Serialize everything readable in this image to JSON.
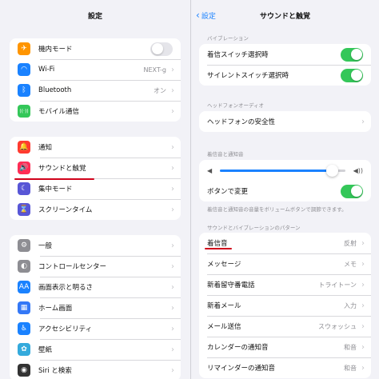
{
  "left": {
    "title": "設定",
    "group1": [
      {
        "label": "機内モード",
        "icon": "airplane-icon",
        "color": "#ff9500",
        "glyph": "✈",
        "control": "toggle-off"
      },
      {
        "label": "Wi-Fi",
        "icon": "wifi-icon",
        "color": "#1a82ff",
        "glyph": "◠",
        "value": "NEXT-g"
      },
      {
        "label": "Bluetooth",
        "icon": "bluetooth-icon",
        "color": "#1a82ff",
        "glyph": "ᛒ",
        "value": "オン"
      },
      {
        "label": "モバイル通信",
        "icon": "cellular-icon",
        "color": "#34c759",
        "glyph": "((·))"
      }
    ],
    "group2": [
      {
        "label": "通知",
        "icon": "bell-icon",
        "color": "#ff3b30",
        "glyph": "🔔"
      },
      {
        "label": "サウンドと触覚",
        "icon": "speaker-icon",
        "color": "#ff2d55",
        "glyph": "🔊"
      },
      {
        "label": "集中モード",
        "icon": "moon-icon",
        "color": "#5856d6",
        "glyph": "☾"
      },
      {
        "label": "スクリーンタイム",
        "icon": "hourglass-icon",
        "color": "#5856d6",
        "glyph": "⌛"
      }
    ],
    "group3": [
      {
        "label": "一般",
        "icon": "gear-icon",
        "color": "#8e8e93",
        "glyph": "⚙"
      },
      {
        "label": "コントロールセンター",
        "icon": "toggles-icon",
        "color": "#8e8e93",
        "glyph": "◐"
      },
      {
        "label": "画面表示と明るさ",
        "icon": "text-size-icon",
        "color": "#1a82ff",
        "glyph": "AA"
      },
      {
        "label": "ホーム画面",
        "icon": "grid-icon",
        "color": "#3478f6",
        "glyph": "▦"
      },
      {
        "label": "アクセシビリティ",
        "icon": "accessibility-icon",
        "color": "#1a82ff",
        "glyph": "♿"
      },
      {
        "label": "壁紙",
        "icon": "wallpaper-icon",
        "color": "#34aadc",
        "glyph": "✿"
      },
      {
        "label": "Siri と検索",
        "icon": "siri-icon",
        "color": "#333333",
        "glyph": "◉"
      }
    ]
  },
  "right": {
    "back_label": "設定",
    "title": "サウンドと触覚",
    "vibration_header": "バイブレーション",
    "vibration": [
      {
        "label": "着信スイッチ選択時",
        "control": "toggle-on"
      },
      {
        "label": "サイレントスイッチ選択時",
        "control": "toggle-on"
      }
    ],
    "headphone_header": "ヘッドフォンオーディオ",
    "headphone": [
      {
        "label": "ヘッドフォンの安全性"
      }
    ],
    "volume_header": "着信音と通知音",
    "volume_level": 0.9,
    "button_change_label": "ボタンで変更",
    "volume_footer": "着信音と通知音の音量をボリュームボタンで調節できます。",
    "patterns_header": "サウンドとバイブレーションのパターン",
    "patterns": [
      {
        "label": "着信音",
        "value": "反射"
      },
      {
        "label": "メッセージ",
        "value": "メモ"
      },
      {
        "label": "新着留守番電話",
        "value": "トライトーン"
      },
      {
        "label": "新着メール",
        "value": "入力"
      },
      {
        "label": "メール送信",
        "value": "スウォッシュ"
      },
      {
        "label": "カレンダーの通知音",
        "value": "和音"
      },
      {
        "label": "リマインダーの通知音",
        "value": "和音"
      }
    ]
  },
  "colors": {
    "accent": "#1a82ff",
    "toggle_on": "#34c759",
    "highlight": "#d0021b"
  }
}
